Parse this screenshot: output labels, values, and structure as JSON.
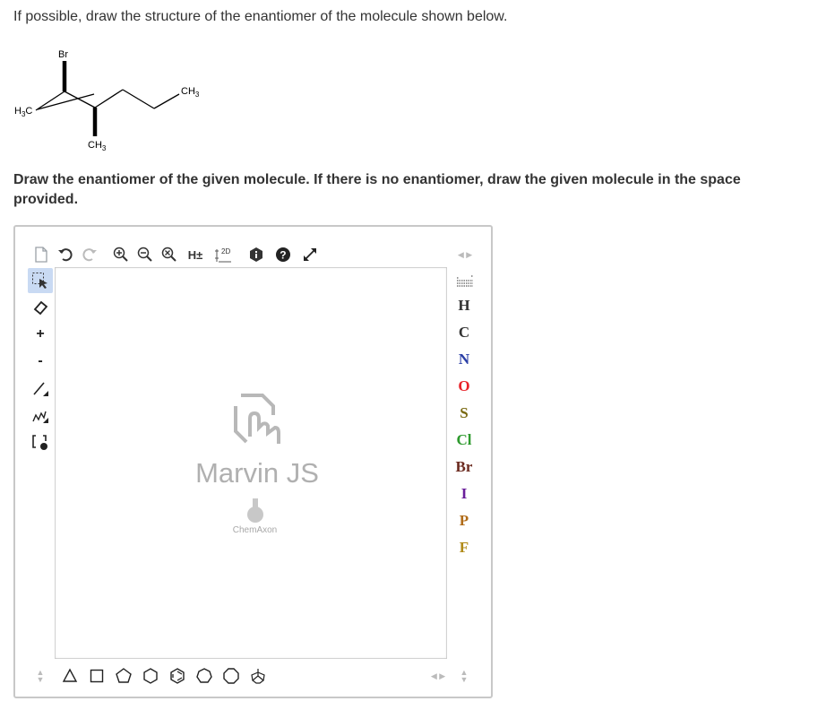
{
  "question": {
    "text": "If possible, draw the structure of the enantiomer of the molecule shown below."
  },
  "molecule": {
    "labels": {
      "br": "Br",
      "ch3_top": "CH3",
      "h3c": "H3C",
      "ch3_bottom": "CH3"
    }
  },
  "instructions": {
    "text": "Draw the enantiomer of the given molecule. If there is no enantiomer, draw the given molecule in the space provided."
  },
  "editor": {
    "toolbar": {
      "new_document": "new-document-icon",
      "undo": "undo-icon",
      "redo": "redo-icon",
      "zoom_in": "zoom-in-icon",
      "zoom_out": "zoom-out-icon",
      "clear": "clear-icon",
      "hydrogens_label": "H±",
      "two_d_label": "2D",
      "info": "info-icon",
      "help": "help-icon",
      "fullscreen": "fullscreen-icon"
    },
    "left_tools": {
      "plus": "+",
      "minus": "-"
    },
    "atoms": [
      {
        "symbol": "H",
        "color": "#333333"
      },
      {
        "symbol": "C",
        "color": "#333333"
      },
      {
        "symbol": "N",
        "color": "#2b3fa6"
      },
      {
        "symbol": "O",
        "color": "#e8232a"
      },
      {
        "symbol": "S",
        "color": "#7a6a12"
      },
      {
        "symbol": "Cl",
        "color": "#2e9a2e"
      },
      {
        "symbol": "Br",
        "color": "#6b2a1f"
      },
      {
        "symbol": "I",
        "color": "#6a1e9a"
      },
      {
        "symbol": "P",
        "color": "#b06b17"
      },
      {
        "symbol": "F",
        "color": "#b08a17"
      }
    ],
    "logo": {
      "title": "Marvin JS",
      "subtitle": "ChemAxon"
    },
    "colors": {
      "border": "#c8c8c8",
      "selected_tool_bg": "#c9daf3",
      "icon_gray": "#555555"
    }
  }
}
